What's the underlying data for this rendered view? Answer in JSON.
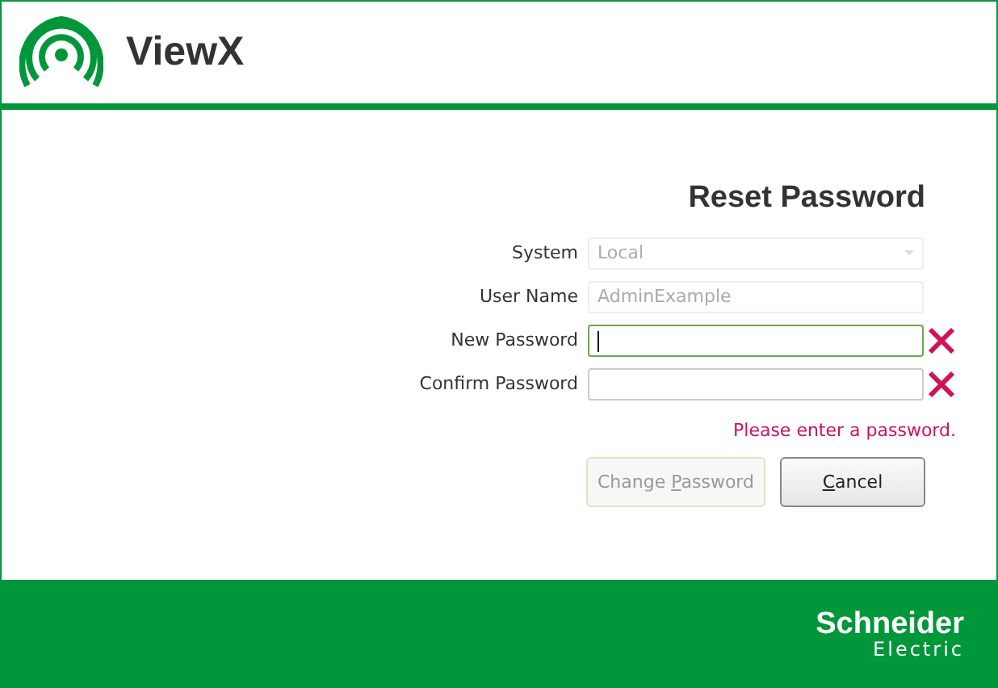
{
  "header": {
    "app_name": "ViewX"
  },
  "form": {
    "title": "Reset Password",
    "fields": [
      {
        "kind": "dropdown",
        "label": "System",
        "value": "Local",
        "disabled": true,
        "focused": false,
        "invalid": false
      },
      {
        "kind": "text",
        "label": "User Name",
        "value": "AdminExample",
        "disabled": true,
        "focused": false,
        "invalid": false
      },
      {
        "kind": "password",
        "label": "New Password",
        "disabled": false,
        "focused": true,
        "invalid": true
      },
      {
        "kind": "password",
        "label": "Confirm Password",
        "disabled": false,
        "focused": false,
        "invalid": true
      }
    ],
    "error": "Please enter a password.",
    "buttons": [
      {
        "before": "Change ",
        "mnemonic": "P",
        "after": "assword",
        "disabled": true
      },
      {
        "mnemonic": "C",
        "after": "ancel",
        "disabled": false
      }
    ]
  },
  "footer": {
    "brand": "Schneider",
    "brand_sub": "Electric"
  }
}
